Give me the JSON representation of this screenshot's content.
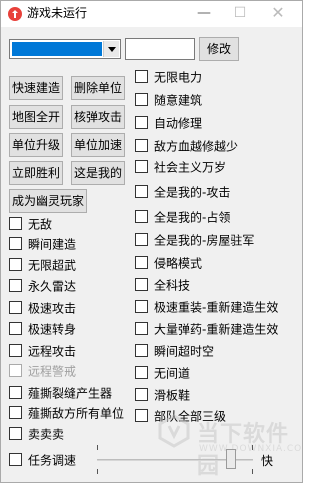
{
  "window": {
    "title": "游戏未运行",
    "minimize": "—",
    "maximize": "☐",
    "close": "✕"
  },
  "top_row": {
    "edit_button": "修改"
  },
  "buttons": {
    "quick_build": "快速建造",
    "delete_unit": "删除单位",
    "map_reveal": "地图全开",
    "nuke_attack": "核弹攻击",
    "unit_upgrade": "单位升级",
    "unit_speed": "单位加速",
    "instant_win": "立即胜利",
    "this_is_mine": "这是我的",
    "become_ghost": "成为幽灵玩家"
  },
  "right_checkboxes": [
    {
      "label": "无限电力",
      "checked": false
    },
    {
      "label": "随意建筑",
      "checked": false
    },
    {
      "label": "自动修理",
      "checked": false
    },
    {
      "label": "敌方血越修越少",
      "checked": false
    },
    {
      "label": "社会主义万岁",
      "checked": false
    },
    {
      "label": "全是我的-攻击",
      "checked": false
    },
    {
      "label": "全是我的-占领",
      "checked": false
    },
    {
      "label": "全是我的-房屋驻军",
      "checked": false
    },
    {
      "label": "侵略模式",
      "checked": false
    },
    {
      "label": "全科技",
      "checked": false
    },
    {
      "label": "极速重装-重新建造生效",
      "checked": false
    },
    {
      "label": "大量弹药-重新建造生效",
      "checked": false
    },
    {
      "label": "瞬间超时空",
      "checked": false
    },
    {
      "label": "无间道",
      "checked": false
    },
    {
      "label": "滑板鞋",
      "checked": false
    },
    {
      "label": "部队全部三级",
      "checked": false
    }
  ],
  "left_checkboxes": [
    {
      "label": "无敌",
      "checked": false,
      "enabled": true
    },
    {
      "label": "瞬间建造",
      "checked": false,
      "enabled": true
    },
    {
      "label": "无限超武",
      "checked": false,
      "enabled": true
    },
    {
      "label": "永久雷达",
      "checked": false,
      "enabled": true
    },
    {
      "label": "极速攻击",
      "checked": false,
      "enabled": true
    },
    {
      "label": "极速转身",
      "checked": false,
      "enabled": true
    },
    {
      "label": "远程攻击",
      "checked": false,
      "enabled": true
    },
    {
      "label": "远程警戒",
      "checked": false,
      "enabled": false
    },
    {
      "label": "薤撕裂缝产生器",
      "checked": false,
      "enabled": true
    },
    {
      "label": "薤撕敌方所有单位",
      "checked": false,
      "enabled": true
    },
    {
      "label": "卖卖卖",
      "checked": false,
      "enabled": true
    },
    {
      "label": "任务调速",
      "checked": false,
      "enabled": true
    }
  ],
  "speed_slider": {
    "value_label": "快",
    "level": 0.85
  },
  "watermark": {
    "text": "当下软件园",
    "url": "WWW.DOWNXIA.COM"
  },
  "colors": {
    "selection": "#0078d7",
    "background": "#f0f0f0",
    "button_face": "#e1e1e1",
    "disabled_text": "#a0a0a0"
  }
}
